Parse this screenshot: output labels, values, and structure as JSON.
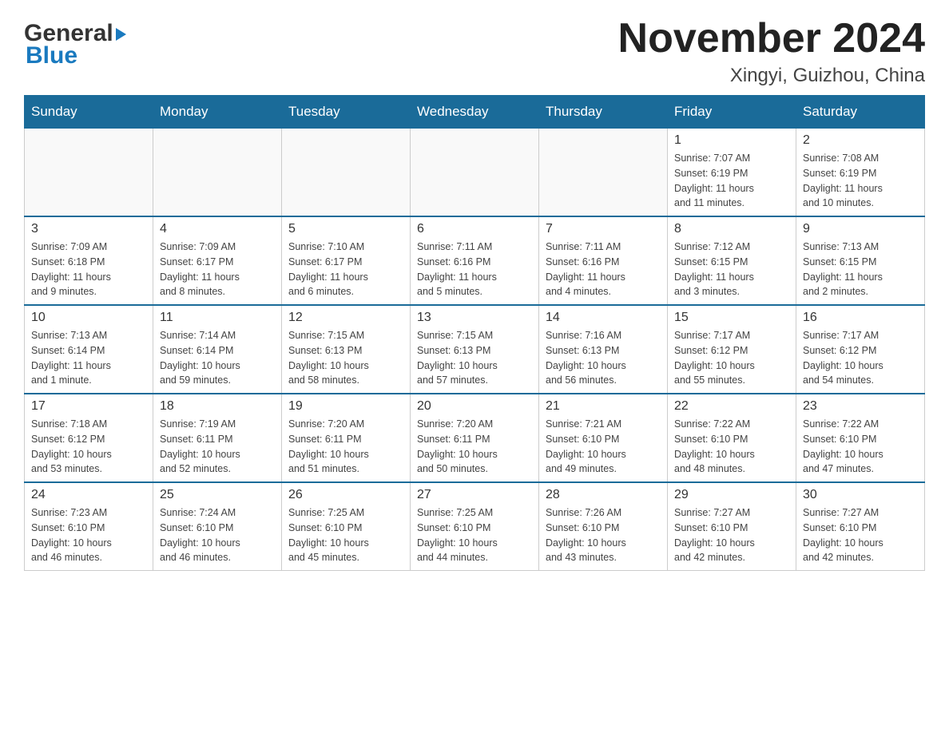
{
  "logo": {
    "general": "General",
    "blue": "Blue",
    "triangle": "▶"
  },
  "title": "November 2024",
  "subtitle": "Xingyi, Guizhou, China",
  "weekdays": [
    "Sunday",
    "Monday",
    "Tuesday",
    "Wednesday",
    "Thursday",
    "Friday",
    "Saturday"
  ],
  "weeks": [
    [
      {
        "day": "",
        "info": ""
      },
      {
        "day": "",
        "info": ""
      },
      {
        "day": "",
        "info": ""
      },
      {
        "day": "",
        "info": ""
      },
      {
        "day": "",
        "info": ""
      },
      {
        "day": "1",
        "info": "Sunrise: 7:07 AM\nSunset: 6:19 PM\nDaylight: 11 hours\nand 11 minutes."
      },
      {
        "day": "2",
        "info": "Sunrise: 7:08 AM\nSunset: 6:19 PM\nDaylight: 11 hours\nand 10 minutes."
      }
    ],
    [
      {
        "day": "3",
        "info": "Sunrise: 7:09 AM\nSunset: 6:18 PM\nDaylight: 11 hours\nand 9 minutes."
      },
      {
        "day": "4",
        "info": "Sunrise: 7:09 AM\nSunset: 6:17 PM\nDaylight: 11 hours\nand 8 minutes."
      },
      {
        "day": "5",
        "info": "Sunrise: 7:10 AM\nSunset: 6:17 PM\nDaylight: 11 hours\nand 6 minutes."
      },
      {
        "day": "6",
        "info": "Sunrise: 7:11 AM\nSunset: 6:16 PM\nDaylight: 11 hours\nand 5 minutes."
      },
      {
        "day": "7",
        "info": "Sunrise: 7:11 AM\nSunset: 6:16 PM\nDaylight: 11 hours\nand 4 minutes."
      },
      {
        "day": "8",
        "info": "Sunrise: 7:12 AM\nSunset: 6:15 PM\nDaylight: 11 hours\nand 3 minutes."
      },
      {
        "day": "9",
        "info": "Sunrise: 7:13 AM\nSunset: 6:15 PM\nDaylight: 11 hours\nand 2 minutes."
      }
    ],
    [
      {
        "day": "10",
        "info": "Sunrise: 7:13 AM\nSunset: 6:14 PM\nDaylight: 11 hours\nand 1 minute."
      },
      {
        "day": "11",
        "info": "Sunrise: 7:14 AM\nSunset: 6:14 PM\nDaylight: 10 hours\nand 59 minutes."
      },
      {
        "day": "12",
        "info": "Sunrise: 7:15 AM\nSunset: 6:13 PM\nDaylight: 10 hours\nand 58 minutes."
      },
      {
        "day": "13",
        "info": "Sunrise: 7:15 AM\nSunset: 6:13 PM\nDaylight: 10 hours\nand 57 minutes."
      },
      {
        "day": "14",
        "info": "Sunrise: 7:16 AM\nSunset: 6:13 PM\nDaylight: 10 hours\nand 56 minutes."
      },
      {
        "day": "15",
        "info": "Sunrise: 7:17 AM\nSunset: 6:12 PM\nDaylight: 10 hours\nand 55 minutes."
      },
      {
        "day": "16",
        "info": "Sunrise: 7:17 AM\nSunset: 6:12 PM\nDaylight: 10 hours\nand 54 minutes."
      }
    ],
    [
      {
        "day": "17",
        "info": "Sunrise: 7:18 AM\nSunset: 6:12 PM\nDaylight: 10 hours\nand 53 minutes."
      },
      {
        "day": "18",
        "info": "Sunrise: 7:19 AM\nSunset: 6:11 PM\nDaylight: 10 hours\nand 52 minutes."
      },
      {
        "day": "19",
        "info": "Sunrise: 7:20 AM\nSunset: 6:11 PM\nDaylight: 10 hours\nand 51 minutes."
      },
      {
        "day": "20",
        "info": "Sunrise: 7:20 AM\nSunset: 6:11 PM\nDaylight: 10 hours\nand 50 minutes."
      },
      {
        "day": "21",
        "info": "Sunrise: 7:21 AM\nSunset: 6:10 PM\nDaylight: 10 hours\nand 49 minutes."
      },
      {
        "day": "22",
        "info": "Sunrise: 7:22 AM\nSunset: 6:10 PM\nDaylight: 10 hours\nand 48 minutes."
      },
      {
        "day": "23",
        "info": "Sunrise: 7:22 AM\nSunset: 6:10 PM\nDaylight: 10 hours\nand 47 minutes."
      }
    ],
    [
      {
        "day": "24",
        "info": "Sunrise: 7:23 AM\nSunset: 6:10 PM\nDaylight: 10 hours\nand 46 minutes."
      },
      {
        "day": "25",
        "info": "Sunrise: 7:24 AM\nSunset: 6:10 PM\nDaylight: 10 hours\nand 46 minutes."
      },
      {
        "day": "26",
        "info": "Sunrise: 7:25 AM\nSunset: 6:10 PM\nDaylight: 10 hours\nand 45 minutes."
      },
      {
        "day": "27",
        "info": "Sunrise: 7:25 AM\nSunset: 6:10 PM\nDaylight: 10 hours\nand 44 minutes."
      },
      {
        "day": "28",
        "info": "Sunrise: 7:26 AM\nSunset: 6:10 PM\nDaylight: 10 hours\nand 43 minutes."
      },
      {
        "day": "29",
        "info": "Sunrise: 7:27 AM\nSunset: 6:10 PM\nDaylight: 10 hours\nand 42 minutes."
      },
      {
        "day": "30",
        "info": "Sunrise: 7:27 AM\nSunset: 6:10 PM\nDaylight: 10 hours\nand 42 minutes."
      }
    ]
  ]
}
